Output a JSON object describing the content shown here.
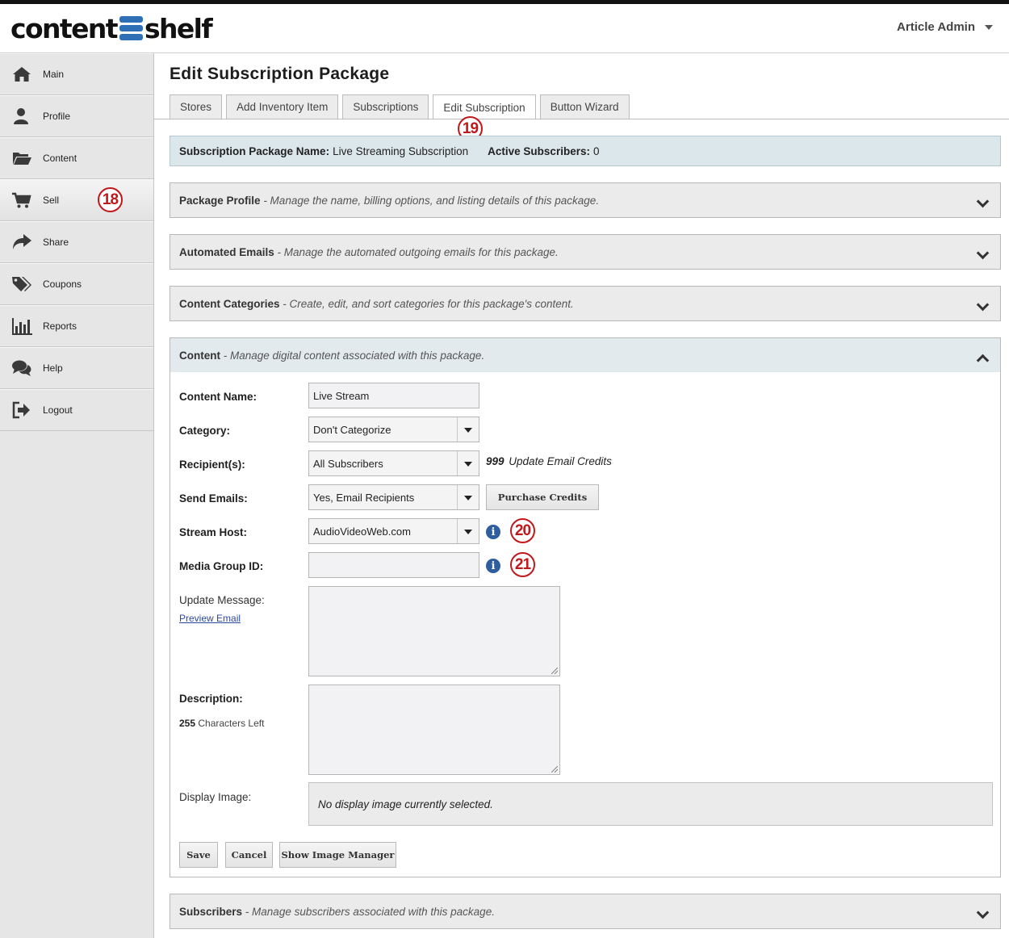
{
  "app": {
    "logo_left": "content",
    "logo_right": "shelf",
    "user_menu": "Article Admin"
  },
  "sidebar": {
    "items": [
      {
        "label": "Main",
        "icon": "home-icon"
      },
      {
        "label": "Profile",
        "icon": "user-icon"
      },
      {
        "label": "Content",
        "icon": "folder-icon"
      },
      {
        "label": "Sell",
        "icon": "cart-icon"
      },
      {
        "label": "Share",
        "icon": "share-icon"
      },
      {
        "label": "Coupons",
        "icon": "tags-icon"
      },
      {
        "label": "Reports",
        "icon": "bar-chart-icon"
      },
      {
        "label": "Help",
        "icon": "chat-icon"
      },
      {
        "label": "Logout",
        "icon": "logout-icon"
      }
    ],
    "active": "Sell"
  },
  "callouts": {
    "c18": "18",
    "c19": "19",
    "c20": "20",
    "c21": "21"
  },
  "page": {
    "title": "Edit Subscription Package",
    "tabs": [
      "Stores",
      "Add Inventory Item",
      "Subscriptions",
      "Edit Subscription",
      "Button Wizard"
    ],
    "active_tab": "Edit Subscription"
  },
  "info_bar": {
    "name_label": "Subscription Package Name:",
    "name_value": "Live Streaming Subscription",
    "subs_label": "Active Subscribers:",
    "subs_value": "0"
  },
  "panels": {
    "package_profile": {
      "title": "Package Profile",
      "desc": " - Manage the name, billing options, and listing details of this package."
    },
    "automated_emails": {
      "title": "Automated Emails",
      "desc": " - Manage the automated outgoing emails for this package."
    },
    "content_categories": {
      "title": "Content Categories",
      "desc": " - Create, edit, and sort categories for this package's content."
    },
    "content": {
      "title": "Content",
      "desc": " - Manage digital content associated with this package."
    },
    "subscribers": {
      "title": "Subscribers",
      "desc": " - Manage subscribers associated with this package."
    }
  },
  "form": {
    "content_name_label": "Content Name:",
    "content_name_value": "Live Stream",
    "category_label": "Category:",
    "category_value": "Don't Categorize",
    "recipients_label": "Recipient(s):",
    "recipients_value": "All Subscribers",
    "credits_count": "999",
    "credits_text": "Update Email Credits",
    "send_emails_label": "Send Emails:",
    "send_emails_value": "Yes, Email Recipients",
    "purchase_credits": "Purchase Credits",
    "stream_host_label": "Stream Host:",
    "stream_host_value": "AudioVideoWeb.com",
    "media_group_label": "Media Group ID:",
    "media_group_value": "",
    "update_message_label": "Update Message:",
    "preview_email": "Preview Email",
    "description_label": "Description:",
    "chars_left_count": "255",
    "chars_left_text": "Characters Left",
    "display_image_label": "Display Image:",
    "display_image_empty": "No display image currently selected.",
    "save": "Save",
    "cancel": "Cancel",
    "show_image_manager": "Show Image Manager"
  },
  "colors": {
    "accent_blue": "#2f6fb5",
    "callout_red": "#c0181b",
    "info_bar_bg": "#dce7ec"
  }
}
